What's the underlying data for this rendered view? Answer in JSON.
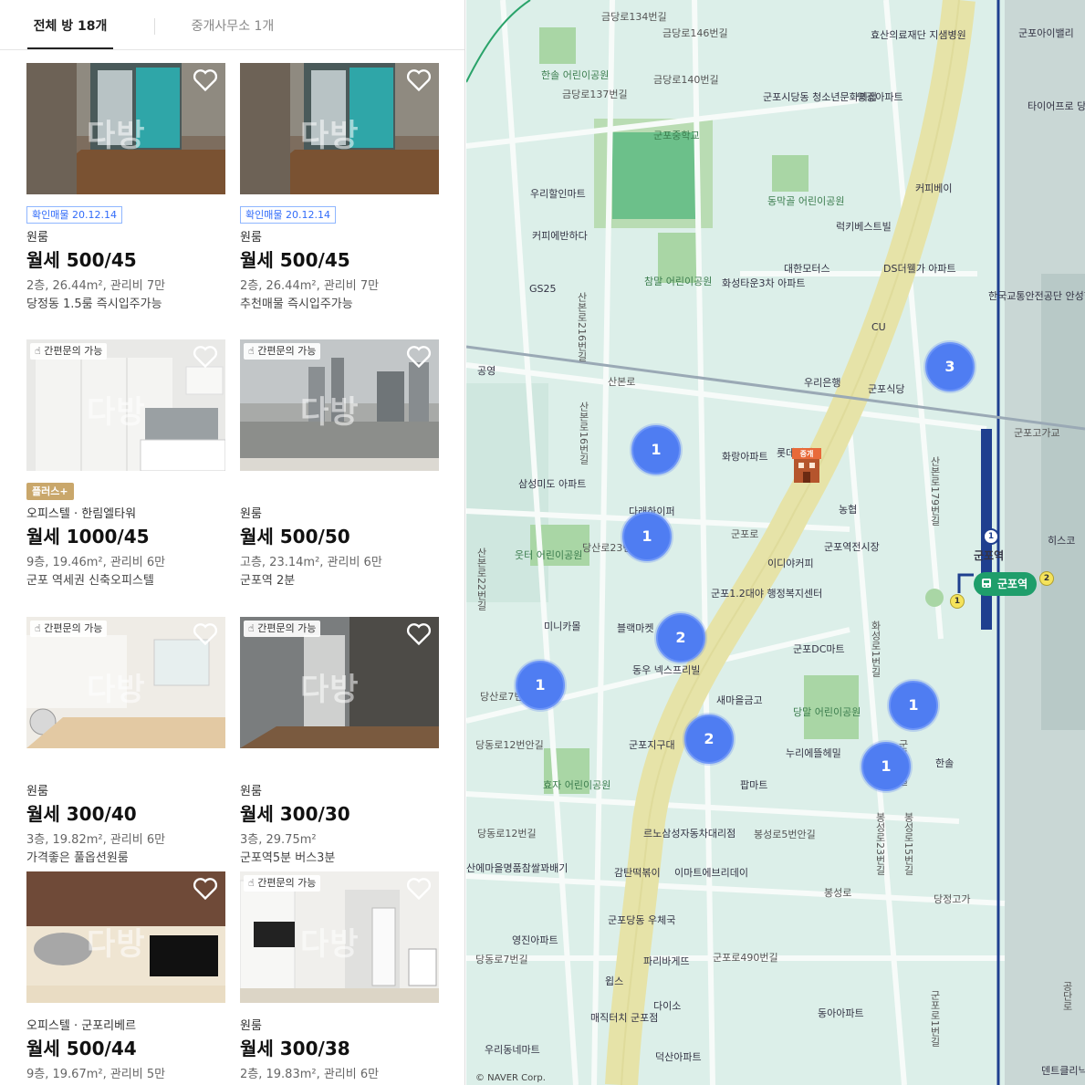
{
  "tabs": [
    {
      "label": "전체 방 18개"
    },
    {
      "label": "중개사무소 1개"
    }
  ],
  "watermark": "다방",
  "listings": [
    {
      "badge": "확인매물 20.12.14",
      "type": "원룸",
      "price": "월세 500/45",
      "spec": "2층, 26.44m², 관리비 7만",
      "desc": "당정동 1.5룸 즉시입주가능"
    },
    {
      "badge": "확인매물 20.12.14",
      "type": "원룸",
      "price": "월세 500/45",
      "spec": "2층, 26.44m², 관리비 7만",
      "desc": "추천매물 즉시입주가능"
    },
    {
      "inquiry": "간편문의 가능",
      "badge": "플러스+",
      "type": "오피스텔 · 한림엘타워",
      "price": "월세 1000/45",
      "spec": "9층, 19.46m², 관리비 6만",
      "desc": "군포 역세권 신축오피스텔"
    },
    {
      "inquiry": "간편문의 가능",
      "type": "원룸",
      "price": "월세 500/50",
      "spec": "고층, 23.14m², 관리비 6만",
      "desc": "군포역 2분"
    },
    {
      "inquiry": "간편문의 가능",
      "type": "원룸",
      "price": "월세 300/40",
      "spec": "3층, 19.82m², 관리비 6만",
      "desc": "가격좋은 풀옵션원룸"
    },
    {
      "inquiry": "간편문의 가능",
      "type": "원룸",
      "price": "월세 300/30",
      "spec": "3층, 29.75m²",
      "desc": "군포역5분 버스3분"
    },
    {
      "type": "오피스텔 · 군포리베르",
      "price": "월세 500/44",
      "spec": "9층, 19.67m², 관리비 5만",
      "desc": ""
    },
    {
      "inquiry": "간편문의 가능",
      "type": "원룸",
      "price": "월세 300/38",
      "spec": "2층, 19.83m², 관리비 6만",
      "desc": ""
    }
  ],
  "map": {
    "clusters": [
      "3",
      "1",
      "1",
      "2",
      "1",
      "2",
      "1",
      "1"
    ],
    "agent_marker_label": "중개",
    "station_name": "군포역",
    "station_badge": "군포역",
    "line1": "1",
    "line2": "2",
    "copyright": "© NAVER Corp.",
    "labels": [
      "금당로146번길",
      "금당로140번길",
      "금당로137번길",
      "금당로134번길",
      "효산의료재단 지샘병원",
      "군포아이밸리",
      "한솔 어린이공원",
      "군포시당동 청소년문화의집",
      "영광아파트",
      "타이어프로 당동점",
      "군포중학교",
      "동막골 어린이공원",
      "커피베이",
      "우리할인마트",
      "커피에반하다",
      "럭키베스트빌",
      "대한모터스",
      "DS더웰가 아파트",
      "GS25",
      "참말 어린이공원",
      "화성타운3차 아파트",
      "한국교통안전공단 안성현대검사장",
      "CU",
      "공영",
      "산본로",
      "우리은행",
      "군포식당",
      "군포고가교",
      "삼성미도 아파트",
      "화랑아파트",
      "롯데리아",
      "다래하이퍼",
      "농협",
      "산본로179번길",
      "산본로216번길",
      "산본로22번길",
      "웃터 어린이공원",
      "당산로23번길",
      "군포로",
      "이디야커피",
      "군포역전시장",
      "군포1.2대야 행정복지센터",
      "미니카몰",
      "블랙마켓",
      "동우 넥스프리빌",
      "군포DC마트",
      "당산로7번길",
      "새마을금고",
      "당말 어린이공원",
      "누리에뜰헤밀",
      "당동로12번안길",
      "군포지구대",
      "팝마트",
      "한솔",
      "효자 어린이공원",
      "당동로12번길",
      "르노삼성자동차대리점",
      "봉성로5번안길",
      "봉성로",
      "산에마을명품참쌀꽈배기",
      "감탄떡볶이",
      "이마트에브리데이",
      "당정고가",
      "영진아파트",
      "군포당동 우체국",
      "파리바게뜨",
      "군포로490번길",
      "당동로7번길",
      "윕스",
      "다이소",
      "동아아파트",
      "매직터치 군포점",
      "우리동네마트",
      "덕산아파트",
      "덴트클리닉",
      "히스코",
      "화성로1번길",
      "군포로1번길",
      "군포로1길",
      "봉성로23번길",
      "봉성로15번길",
      "산본로16번길",
      "공단로"
    ]
  },
  "colors": {
    "accent": "#326cf9",
    "cluster": "#4f7df2",
    "map_bg": "#dcefe9",
    "road_main": "#e6e3a8",
    "rail": "#1f3f8f",
    "station": "#1f9e6b",
    "plus_badge": "#c9a76b"
  }
}
